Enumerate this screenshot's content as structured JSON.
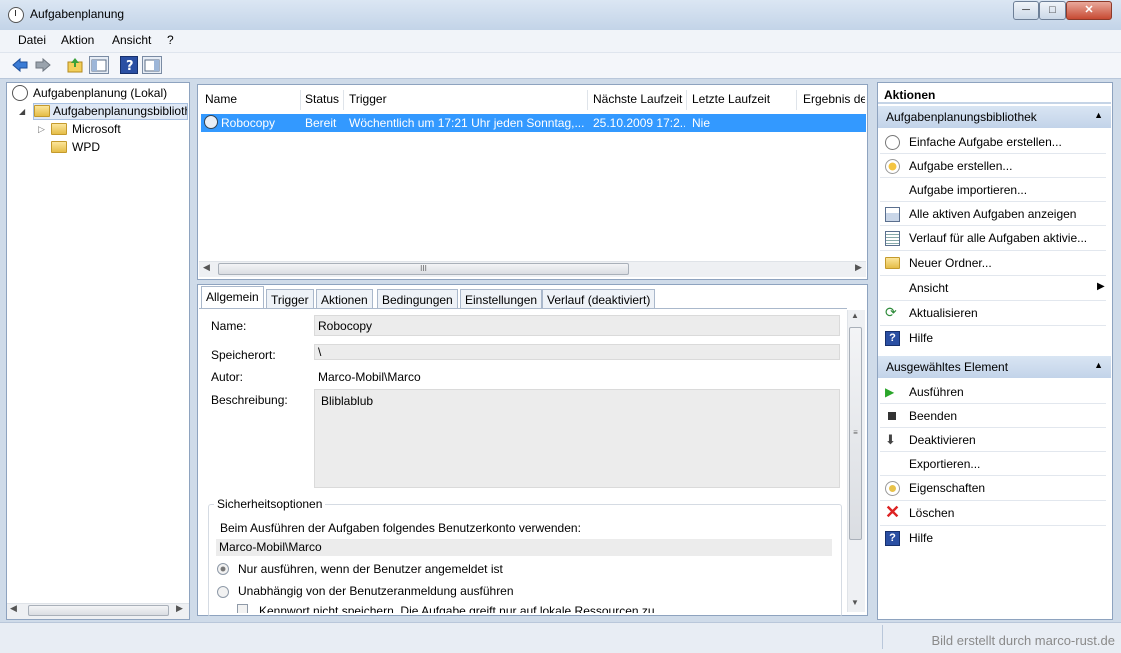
{
  "window": {
    "title": "Aufgabenplanung",
    "minimize": "─",
    "maximize": "□",
    "close": "✕"
  },
  "menu": [
    "Datei",
    "Aktion",
    "Ansicht",
    "?"
  ],
  "tree": {
    "root": "Aufgabenplanung (Lokal)",
    "library": "Aufgabenplanungsbibliothek",
    "children": [
      "Microsoft",
      "WPD"
    ]
  },
  "tasks": {
    "columns": [
      "Name",
      "Status",
      "Trigger",
      "Nächste Laufzeit",
      "Letzte Laufzeit",
      "Ergebnis der"
    ],
    "rows": [
      {
        "name": "Robocopy",
        "status": "Bereit",
        "trigger": "Wöchentlich um 17:21 Uhr jeden Sonntag,...",
        "next_run": "25.10.2009 17:2...",
        "last_run": "Nie"
      }
    ]
  },
  "tabs": [
    "Allgemein",
    "Trigger",
    "Aktionen",
    "Bedingungen",
    "Einstellungen",
    "Verlauf (deaktiviert)"
  ],
  "general": {
    "name_label": "Name:",
    "name_value": "Robocopy",
    "location_label": "Speicherort:",
    "location_value": "\\",
    "author_label": "Autor:",
    "author_value": "Marco-Mobil\\Marco",
    "description_label": "Beschreibung:",
    "description_value": "Bliblablub",
    "security_title": "Sicherheitsoptionen",
    "security_text": "Beim Ausführen der Aufgaben folgendes Benutzerkonto verwenden:",
    "security_user": "Marco-Mobil\\Marco",
    "option1": "Nur ausführen, wenn der Benutzer angemeldet ist",
    "option2": "Unabhängig von der Benutzeranmeldung ausführen",
    "option3": "Kennwort nicht speichern. Die Aufgabe greift nur auf lokale Ressourcen zu."
  },
  "actions": {
    "header": "Aktionen",
    "section1": "Aufgabenplanungsbibliothek",
    "section1_items": [
      "Einfache Aufgabe erstellen...",
      "Aufgabe erstellen...",
      "Aufgabe importieren...",
      "Alle aktiven Aufgaben anzeigen",
      "Verlauf für alle Aufgaben aktivie...",
      "Neuer Ordner...",
      "Ansicht",
      "Aktualisieren",
      "Hilfe"
    ],
    "section2": "Ausgewähltes Element",
    "section2_items": [
      "Ausführen",
      "Beenden",
      "Deaktivieren",
      "Exportieren...",
      "Eigenschaften",
      "Löschen",
      "Hilfe"
    ]
  },
  "statusbar": {
    "watermark": "Bild erstellt durch marco-rust.de"
  },
  "colors": {
    "selection": "#3399ff",
    "section_header": "#c2d3e9",
    "delete_red": "#d22"
  }
}
